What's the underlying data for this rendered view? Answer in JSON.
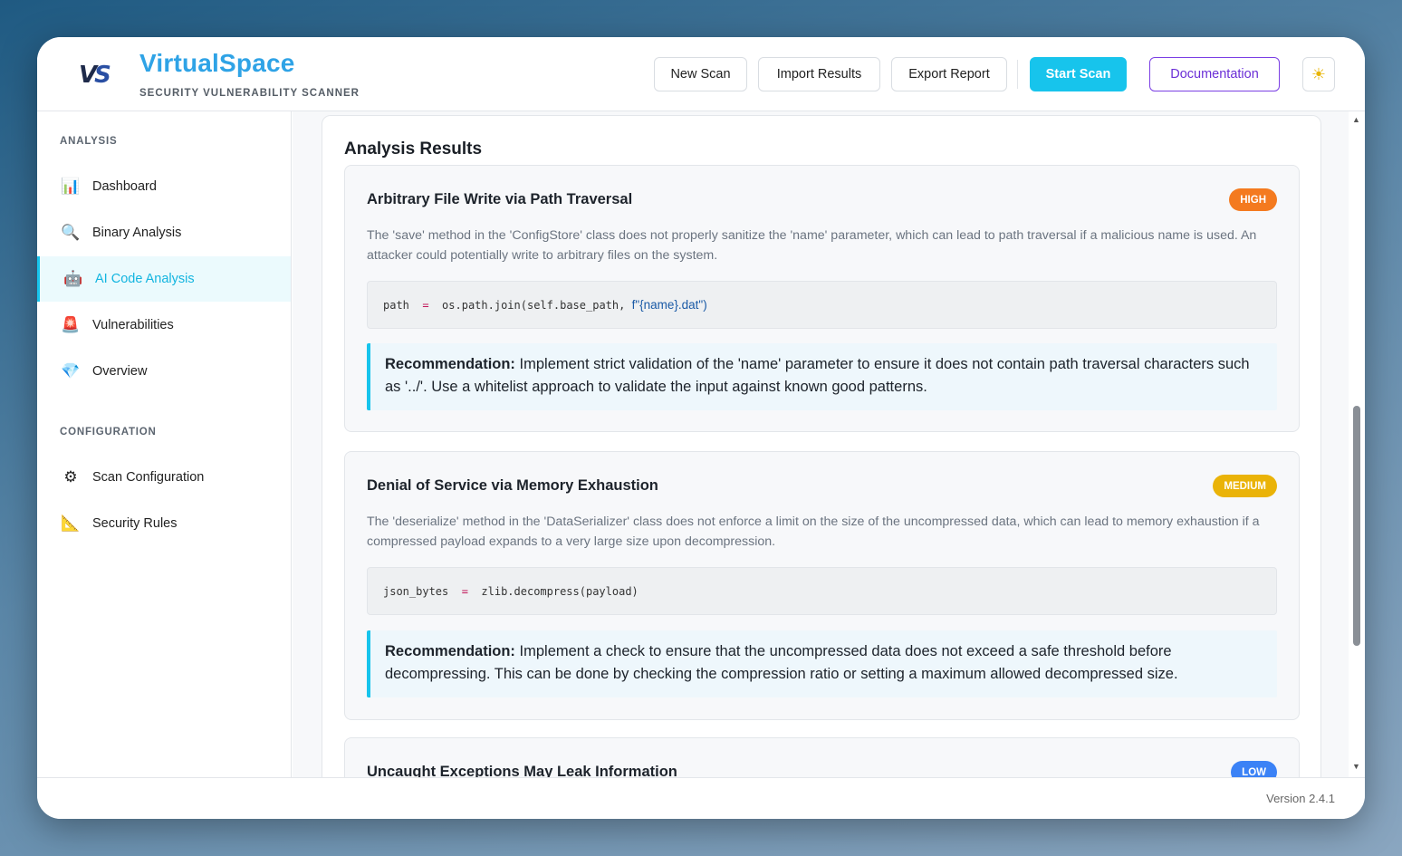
{
  "header": {
    "logo_left": "V",
    "logo_right": "S",
    "title": "VirtualSpace",
    "subtitle": "SECURITY VULNERABILITY SCANNER",
    "buttons": {
      "new_scan": "New Scan",
      "import_results": "Import Results",
      "export_report": "Export Report",
      "start_scan": "Start Scan",
      "documentation": "Documentation",
      "theme_icon": "☀"
    }
  },
  "sidebar": {
    "analysis_label": "ANALYSIS",
    "configuration_label": "CONFIGURATION",
    "items": [
      {
        "label": "Dashboard",
        "icon": "📊",
        "icon_name": "bar-chart-icon"
      },
      {
        "label": "Binary Analysis",
        "icon": "🔍",
        "icon_name": "magnifier-icon"
      },
      {
        "label": "AI Code Analysis",
        "icon": "🤖",
        "icon_name": "robot-icon",
        "active": true
      },
      {
        "label": "Vulnerabilities",
        "icon": "🚨",
        "icon_name": "alert-icon"
      },
      {
        "label": "Overview",
        "icon": "💎",
        "icon_name": "gem-icon"
      },
      {
        "label": "Scan Configuration",
        "icon": "⚙",
        "icon_name": "gear-icon"
      },
      {
        "label": "Security Rules",
        "icon": "📐",
        "icon_name": "ruler-icon"
      }
    ]
  },
  "main": {
    "title": "Analysis Results",
    "findings": [
      {
        "title": "Arbitrary File Write via Path Traversal",
        "severity": "HIGH",
        "severity_color": "#f47a1f",
        "description": "The 'save' method in the 'ConfigStore' class does not properly sanitize the 'name' parameter, which can lead to path traversal if a malicious name is used. An attacker could potentially write to arbitrary files on the system.",
        "code_lhs": "path",
        "code_op": "=",
        "code_rhs": "os.path.join(self.base_path,",
        "code_str": "f\"{name}.dat\")",
        "rec_label": "Recommendation:",
        "rec_text": " Implement strict validation of the 'name' parameter to ensure it does not contain path traversal characters such as '../'. Use a whitelist approach to validate the input against known good patterns."
      },
      {
        "title": "Denial of Service via Memory Exhaustion",
        "severity": "MEDIUM",
        "severity_color": "#eab308",
        "description": "The 'deserialize' method in the 'DataSerializer' class does not enforce a limit on the size of the uncompressed data, which can lead to memory exhaustion if a compressed payload expands to a very large size upon decompression.",
        "code_lhs": "json_bytes",
        "code_op": "=",
        "code_rhs": "zlib.decompress(payload)",
        "code_str": "",
        "rec_label": "Recommendation:",
        "rec_text": " Implement a check to ensure that the uncompressed data does not exceed a safe threshold before decompressing. This can be done by checking the compression ratio or setting a maximum allowed decompressed size."
      },
      {
        "title": "Uncaught Exceptions May Leak Information",
        "severity": "LOW",
        "severity_color": "#3b82f6"
      }
    ]
  },
  "footer": {
    "version": "Version 2.4.1"
  }
}
